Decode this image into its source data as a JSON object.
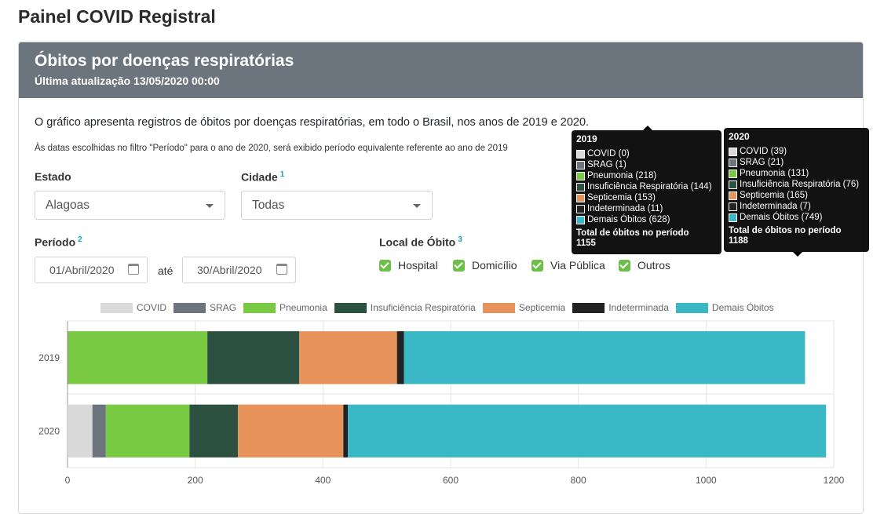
{
  "page": {
    "title": "Painel COVID Registral"
  },
  "card": {
    "title": "Óbitos por doenças respiratórias",
    "updated": "Última atualização 13/05/2020 00:00",
    "description": "O gráfico apresenta registros de óbitos por doenças respiratórias, em todo o Brasil, nos anos de 2019 e 2020.",
    "note": "Às datas escolhidas no filtro \"Período\" para o ano de 2020, será exibido período equivalente referente ao ano de 2019"
  },
  "filters": {
    "estado": {
      "label": "Estado",
      "value": "Alagoas"
    },
    "cidade": {
      "label": "Cidade",
      "sup": "1",
      "value": "Todas"
    },
    "periodo": {
      "label": "Período",
      "sup": "2",
      "start": "01/Abril/2020",
      "sep": "até",
      "end": "30/Abril/2020"
    },
    "local": {
      "label": "Local de Óbito",
      "sup": "3",
      "options": [
        {
          "label": "Hospital",
          "checked": true
        },
        {
          "label": "Domicílio",
          "checked": true
        },
        {
          "label": "Via Pública",
          "checked": true
        },
        {
          "label": "Outros",
          "checked": true
        }
      ]
    }
  },
  "chart_data": {
    "type": "bar",
    "orientation": "horizontal",
    "stacked": true,
    "categories": [
      "2019",
      "2020"
    ],
    "series": [
      {
        "name": "COVID",
        "color": "#d9d9d9",
        "values": [
          0,
          39
        ]
      },
      {
        "name": "SRAG",
        "color": "#6c757d",
        "values": [
          1,
          21
        ]
      },
      {
        "name": "Pneumonia",
        "color": "#7ac943",
        "values": [
          218,
          131
        ]
      },
      {
        "name": "Insuficiência Respiratória",
        "color": "#2d5141",
        "values": [
          144,
          76
        ]
      },
      {
        "name": "Septicemia",
        "color": "#e8925c",
        "values": [
          153,
          165
        ]
      },
      {
        "name": "Indeterminada",
        "color": "#222222",
        "values": [
          11,
          7
        ]
      },
      {
        "name": "Demais Óbitos",
        "color": "#3bb8c6",
        "values": [
          628,
          749
        ]
      }
    ],
    "xlim": [
      0,
      1200
    ],
    "xticks": [
      0,
      200,
      400,
      600,
      800,
      1000,
      1200
    ],
    "grid": true,
    "legend": "top"
  },
  "tooltips": [
    {
      "title": "2019",
      "total_label": "Total de óbitos no período",
      "total": "1155",
      "rows": [
        "COVID (0)",
        "SRAG (1)",
        "Pneumonia (218)",
        "Insuficiência Respiratória (144)",
        "Septicemia (153)",
        "Indeterminada (11)",
        "Demais Óbitos (628)"
      ]
    },
    {
      "title": "2020",
      "total_label": "Total de óbitos no período",
      "total": "1188",
      "rows": [
        "COVID (39)",
        "SRAG (21)",
        "Pneumonia (131)",
        "Insuficiência Respiratória (76)",
        "Septicemia (165)",
        "Indeterminada (7)",
        "Demais Óbitos (749)"
      ]
    }
  ]
}
